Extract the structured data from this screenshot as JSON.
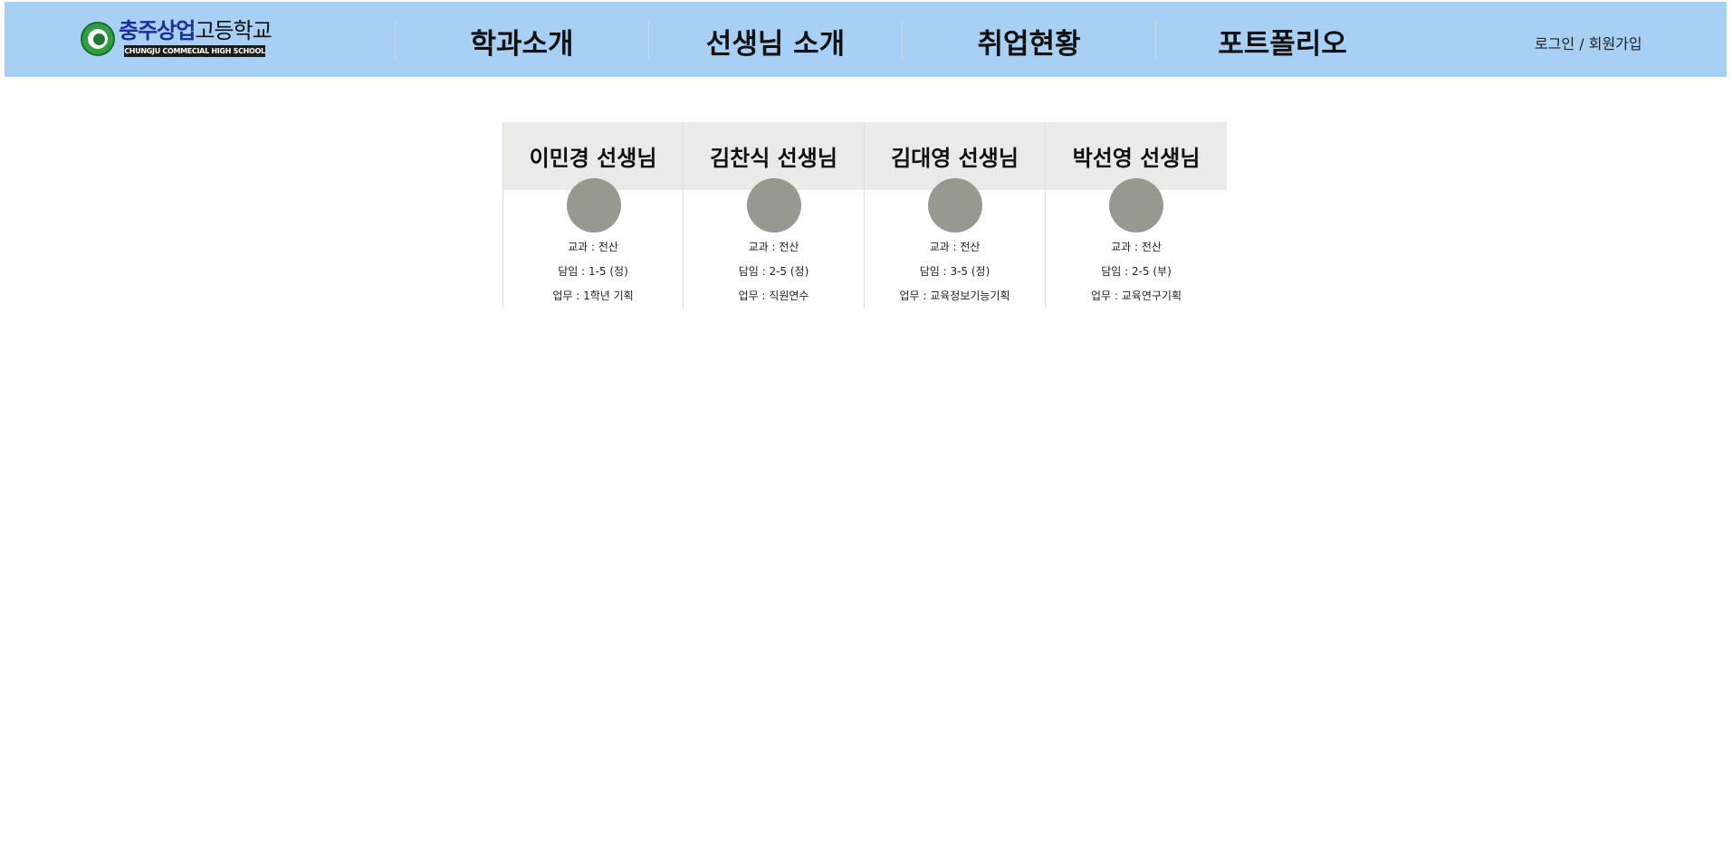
{
  "header": {
    "logo": {
      "name_part1": "충주상업",
      "name_part2": "고등학교",
      "subtitle": "CHUNGJU COMMECIAL HIGH SCHOOL"
    },
    "nav": [
      {
        "label": "학과소개"
      },
      {
        "label": "선생님 소개"
      },
      {
        "label": "취업현황"
      },
      {
        "label": "포트폴리오"
      }
    ],
    "auth": {
      "login": "로그인",
      "separator": " / ",
      "signup": "회원가입"
    },
    "background_color": "#a8cff4"
  },
  "teachers": [
    {
      "name": "이민경 선생님",
      "subject": "교과 : 전산",
      "homeroom": "담임 : 1-5 (정)",
      "duty": "업무 : 1학년 기획"
    },
    {
      "name": "김찬식 선생님",
      "subject": "교과 : 전산",
      "homeroom": "담임 : 2-5 (정)",
      "duty": "업무 : 직원연수"
    },
    {
      "name": "김대영 선생님",
      "subject": "교과 : 전산",
      "homeroom": "담임 : 3-5 (정)",
      "duty": "업무 : 교육정보기능기획"
    },
    {
      "name": "박선영 선생님",
      "subject": "교과 : 전산",
      "homeroom": "담임 : 2-5 (부)",
      "duty": "업무 : 교육연구기획"
    }
  ]
}
